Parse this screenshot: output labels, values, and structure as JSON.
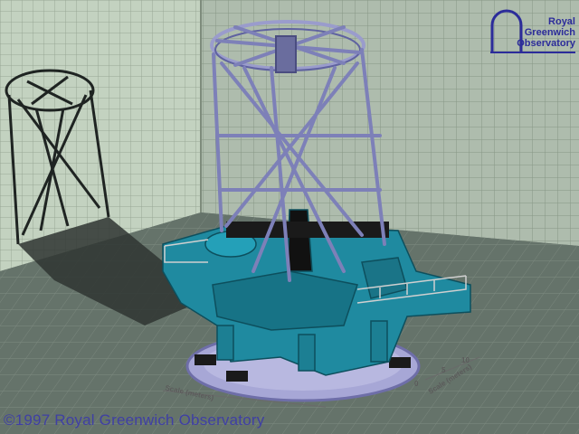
{
  "logo": {
    "line1": "Royal",
    "line2": "Greenwich",
    "line3": "Observatory",
    "color": "#2c2c9a"
  },
  "caption": "©1997 Royal Greenwich Observatory",
  "scale_labels": {
    "left": "Scale (meters)",
    "right": "Scale (meters)",
    "tick_0": "0",
    "tick_5": "5",
    "tick_10": "10"
  },
  "colors": {
    "telescope_frame": "#8a8cc0",
    "mount": "#1f8aa0",
    "wall": "#b9c9b8",
    "floor": "#5f6d64",
    "shadow": "#2a2f2c"
  }
}
